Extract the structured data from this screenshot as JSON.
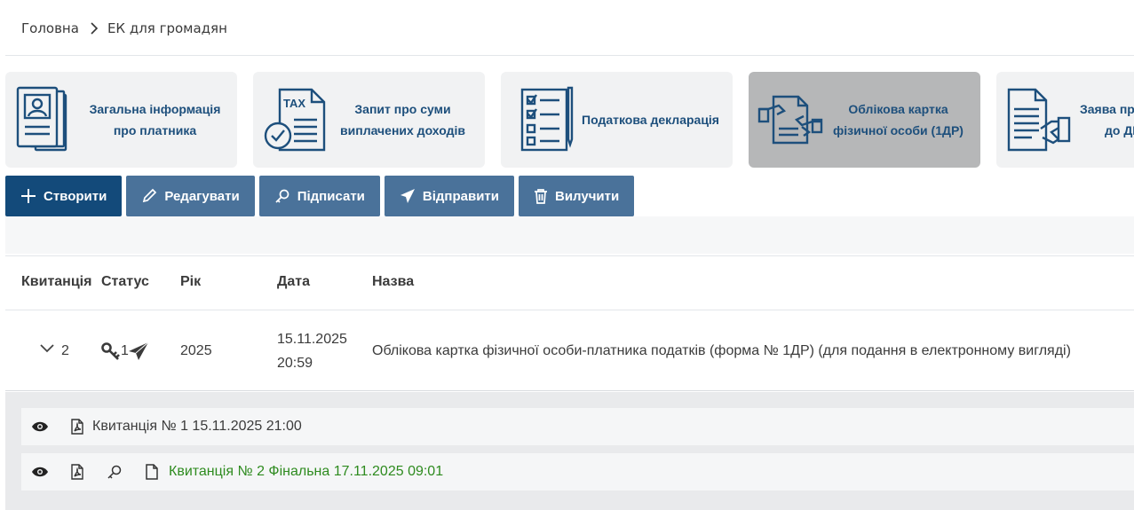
{
  "breadcrumb": {
    "home": "Головна",
    "current": "ЕК для громадян"
  },
  "cards": [
    {
      "line1": "Загальна інформація",
      "line2": "про платника",
      "icon": "person-document-icon"
    },
    {
      "line1": "Запит про суми",
      "line2": "виплачених доходів",
      "icon": "tax-document-icon"
    },
    {
      "line1": "Податкова декларація",
      "line2": "",
      "icon": "checklist-icon"
    },
    {
      "line1": "Облікова картка",
      "line2": "фізичної особи (1ДР)",
      "icon": "handshake-document-icon"
    },
    {
      "line1": "Заява про",
      "line2": "до ДР",
      "icon": "hand-document-icon"
    }
  ],
  "toolbar": {
    "create": "Створити",
    "edit": "Редагувати",
    "sign": "Підписати",
    "send": "Відправити",
    "delete": "Вилучити"
  },
  "table": {
    "headers": {
      "receipt": "Квитанція",
      "status": "Статус",
      "year": "Рік",
      "date": "Дата",
      "name": "Назва"
    },
    "row": {
      "receipt_count": "2",
      "status_num": "1",
      "year": "2025",
      "date": "15.11.2025",
      "time": "20:59",
      "name": "Облікова картка фізичної особи-платника податків (форма № 1ДР) (для подання в електронному вигляді)"
    }
  },
  "receipts": [
    {
      "text": "Квитанція № 1 15.11.2025 21:00"
    },
    {
      "text": "Квитанція № 2 Фінальна 17.11.2025 09:01"
    }
  ],
  "colors": {
    "primary": "#134a7a",
    "button": "#4a729a",
    "card_text": "#1d4f7c",
    "final_receipt": "#2e8b1f"
  }
}
